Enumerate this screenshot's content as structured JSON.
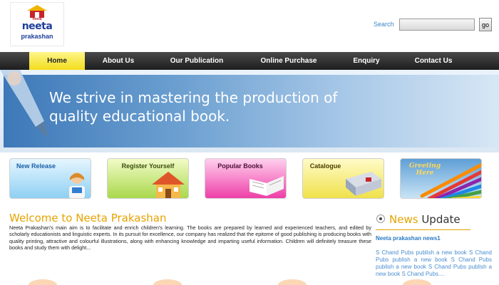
{
  "logo": {
    "line1": "neeta",
    "line2": "neeta",
    "line3": "prakashan"
  },
  "search": {
    "label": "Search",
    "placeholder": "",
    "button": "go"
  },
  "nav": {
    "items": [
      "Home",
      "About Us",
      "Our Publication",
      "Online Purchase",
      "Enquiry",
      "Contact Us"
    ]
  },
  "banner": {
    "line1": "We strive in mastering the production of",
    "line2": "quality educational book."
  },
  "cards": [
    "New Release",
    "Register Yourself",
    "Popular Books",
    "Catalogue",
    "Greeting Here"
  ],
  "welcome": {
    "title": "Welcome to Neeta Prakashan",
    "body": "Neeta Prakashan's main aim is to facilitate and enrich children's learning. The books are prepared by learned and experienced teachers, and edited by scholarly educationists and linguistic experts. In its pursuit for excellence, our company has realized that the epitome of good publishing is producing books with quality printing, attractive and colourful illustrations, along with enhancing knowledge and imparting useful information. Children will definitely treasure these books and study them with delight..."
  },
  "news": {
    "title_a": "News",
    "title_b": "Update",
    "headline": "Neeta prakashan news1",
    "body": "S Chand Pubs publish a new book S Chand Pubs publish a new book S Chand Pubs publish a new book S Chand Pubs publish a new book S Chand Pubs...."
  },
  "colors": {
    "accent": "#e6a300",
    "nav_bg": "#2b2b2b",
    "nav_active": "#f5e33a",
    "link": "#3a86c6"
  }
}
